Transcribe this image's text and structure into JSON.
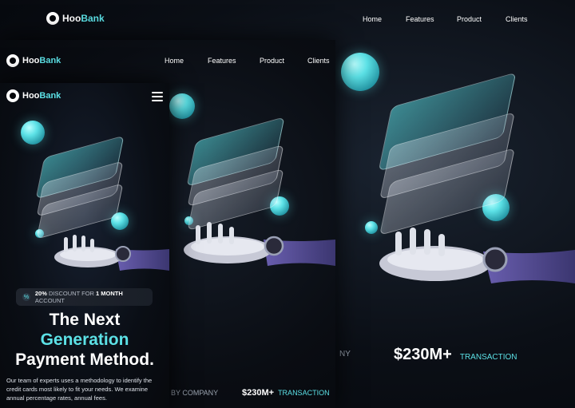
{
  "brand": {
    "name_part1": "Hoo",
    "name_part2": "Bank",
    "accent": "#5ce1e6"
  },
  "nav": {
    "items": [
      "Home",
      "Features",
      "Product",
      "Clients"
    ]
  },
  "desktop": {
    "stat_value": "$230M+",
    "stat_label": "TRANSACTION",
    "partial_text": "NY"
  },
  "tablet": {
    "stat_partial": "BY COMPANY",
    "stat_value": "$230M+",
    "stat_label": "TRANSACTION"
  },
  "mobile": {
    "badge": {
      "percent": "20%",
      "discount_text": "DISCOUNT FOR",
      "period": "1 MONTH",
      "suffix": "ACCOUNT",
      "icon": "percent-icon"
    },
    "headline_line1": "The Next",
    "headline_line2": "Generation",
    "headline_line3": "Payment Method.",
    "body": "Our team of experts uses a methodology to identify the credit cards most likely to fit your needs. We examine annual percentage rates, annual fees."
  },
  "icons": {
    "logo": "hoobank-logo-icon",
    "menu": "hamburger-menu-icon"
  }
}
